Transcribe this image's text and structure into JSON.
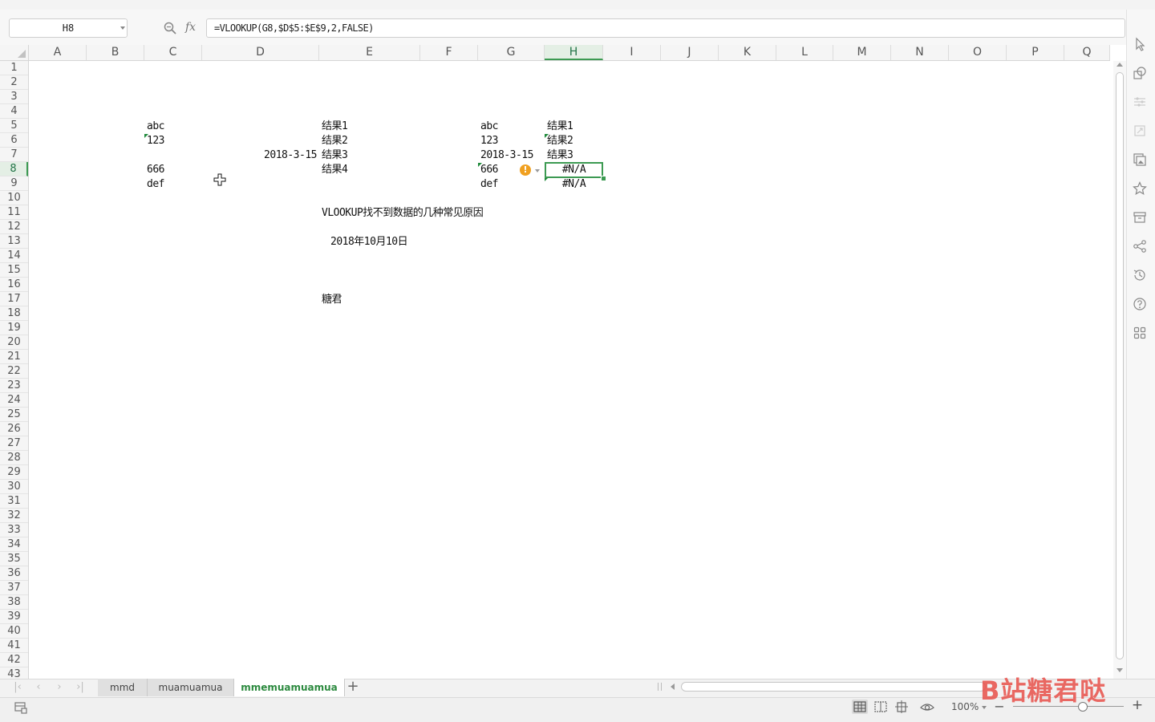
{
  "formula_bar": {
    "name_box": "H8",
    "fx_label": "fx",
    "formula": "=VLOOKUP(G8,$D$5:$E$9,2,FALSE)"
  },
  "columns": [
    "A",
    "B",
    "C",
    "D",
    "E",
    "F",
    "G",
    "H",
    "I",
    "J",
    "K",
    "L",
    "M",
    "N",
    "O",
    "P",
    "Q"
  ],
  "active_column": "H",
  "active_row": "8",
  "rows": [
    "1",
    "2",
    "3",
    "4",
    "5",
    "6",
    "7",
    "8",
    "9",
    "10",
    "11",
    "12",
    "13",
    "14",
    "15",
    "16",
    "17",
    "18",
    "19",
    "20",
    "21",
    "22",
    "23",
    "24",
    "25",
    "26",
    "27",
    "28",
    "29",
    "30",
    "31",
    "32",
    "33",
    "34",
    "35",
    "36",
    "37",
    "38",
    "39",
    "40",
    "41",
    "42",
    "43"
  ],
  "cells": {
    "C5": "abc",
    "C6": "123",
    "C8": "666",
    "C9": "def",
    "D7": "2018-3-15",
    "E5": "结果1",
    "E6": "结果2",
    "E7": "结果3",
    "E8": "结果4",
    "G5": "abc",
    "G6": "123",
    "G7": "2018-3-15",
    "G8": "666",
    "G9": "def",
    "H5": "结果1",
    "H6": "结果2",
    "H7": "结果3",
    "H8": "#N/A",
    "H9": "#N/A",
    "E11": "VLOOKUP找不到数据的几种常见原因",
    "E13": "2018年10月10日",
    "E17": "糖君"
  },
  "sheet_tabs": [
    {
      "label": "mmd",
      "active": false
    },
    {
      "label": "muamuamua",
      "active": false
    },
    {
      "label": "mmemuamuamua",
      "active": true
    }
  ],
  "add_sheet_label": "+",
  "status_bar": {
    "zoom_label": "100%",
    "zoom_percent": 100
  },
  "watermark": "B站糖君哒",
  "icons": {
    "formula_bar": [
      "zoom-icon",
      "fx-icon"
    ],
    "sidebar": [
      "select-arrow-icon",
      "shapes-icon",
      "filter-settings-icon",
      "transform-icon",
      "gallery-icon",
      "star-icon",
      "archive-icon",
      "share-icon",
      "history-icon",
      "help-icon",
      "apps-grid-icon"
    ],
    "status": [
      "sheet-status-icon",
      "normal-view-icon",
      "page-break-view-icon",
      "page-layout-icon",
      "eye-protection-icon"
    ]
  },
  "colors": {
    "accent": "#3c9a52",
    "error_triangle": "#1e8a3a",
    "warning": "#f0a020",
    "watermark": "#e8504a"
  }
}
